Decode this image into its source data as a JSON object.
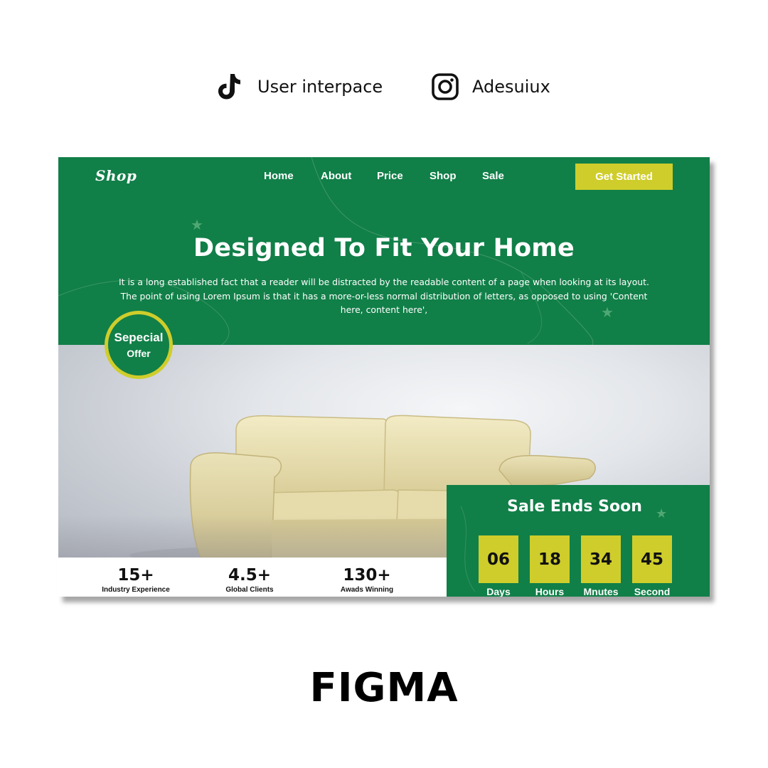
{
  "header": {
    "tiktok": {
      "icon": "tiktok-icon",
      "label": "User interpace"
    },
    "instagram": {
      "icon": "instagram-icon",
      "label": "Adesuiux"
    }
  },
  "site": {
    "logo": "Shop",
    "nav": [
      "Home",
      "About",
      "Price",
      "Shop",
      "Sale"
    ],
    "cta": "Get Started",
    "hero_title": "Designed To Fit Your Home",
    "hero_text_lines": [
      "It is a long established fact that a reader will be distracted by the readable content of a page when looking at its layout.",
      "The point of using Lorem Ipsum is that it has a more-or-less normal distribution of letters, as opposed to using 'Content",
      "here, content here',"
    ],
    "offer": {
      "line1": "Sepecial",
      "line2": "Offer"
    },
    "stats": [
      {
        "value": "15+",
        "label": "Industry Experience"
      },
      {
        "value": "4.5+",
        "label": "Global Clients"
      },
      {
        "value": "130+",
        "label": "Awads Winning"
      }
    ],
    "sale": {
      "title": "Sale Ends Soon",
      "countdown": [
        {
          "value": "06",
          "unit": "Days"
        },
        {
          "value": "18",
          "unit": "Hours"
        },
        {
          "value": "34",
          "unit": "Mnutes"
        },
        {
          "value": "45",
          "unit": "Second"
        }
      ]
    }
  },
  "footer_label": "FIGMA",
  "colors": {
    "brand_green": "#117f48",
    "accent_yellow": "#cfcd2b"
  }
}
